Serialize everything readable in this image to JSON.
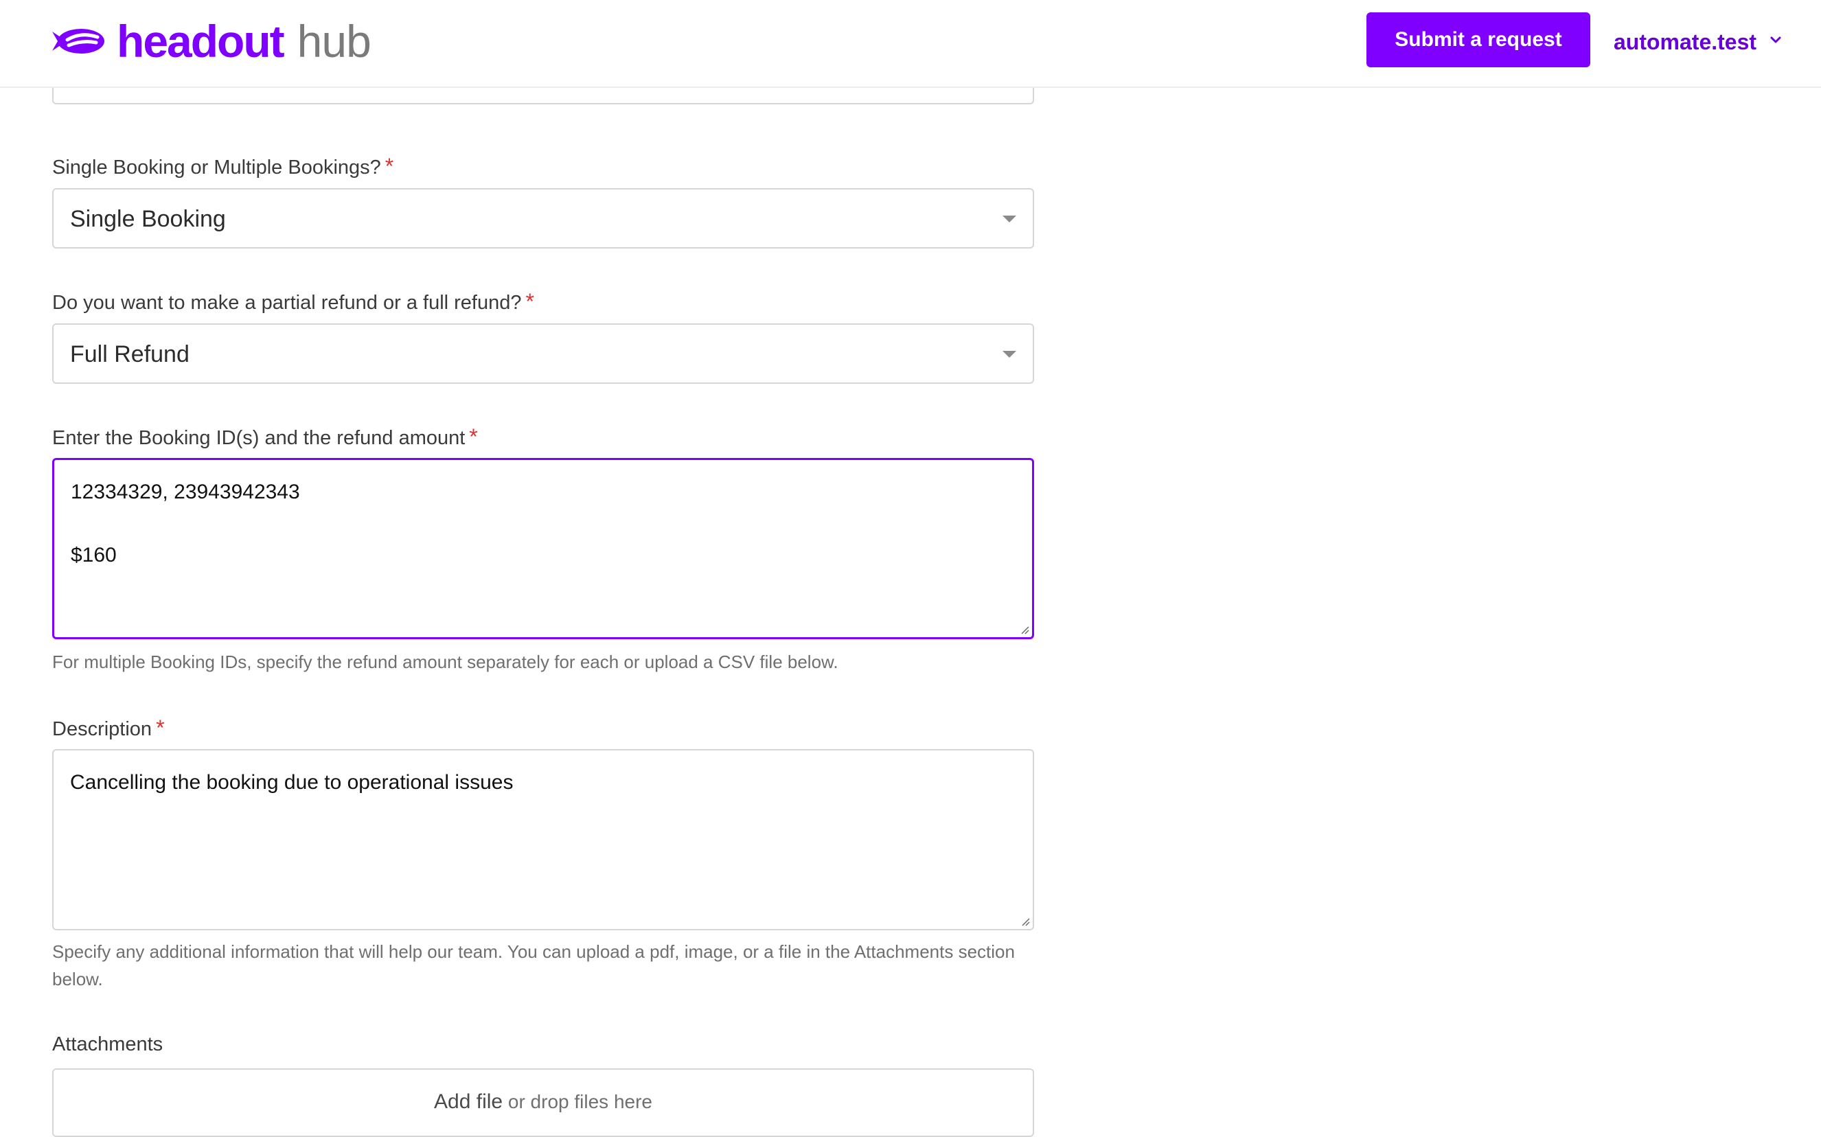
{
  "header": {
    "brand_name": "headout",
    "brand_sub": "hub",
    "submit_label": "Submit a request",
    "user_name": "automate.test",
    "brand_color": "#8000ff"
  },
  "form": {
    "booking_type": {
      "label": "Single Booking or Multiple Bookings?",
      "required_mark": "*",
      "value": "Single Booking"
    },
    "refund_type": {
      "label": "Do you want to make a partial refund or a full refund?",
      "required_mark": "*",
      "value": "Full Refund"
    },
    "booking_ids": {
      "label": "Enter the Booking ID(s) and the refund amount",
      "required_mark": "*",
      "value_lines": [
        "12334329, 23943942343",
        "",
        "$160"
      ],
      "hint": "For multiple Booking IDs, specify the refund amount separately for each or upload a CSV file below."
    },
    "description": {
      "label": "Description",
      "required_mark": "*",
      "value": "Cancelling the booking due to operational issues",
      "hint": "Specify any additional information that will help our team. You can upload a pdf, image, or a file in the Attachments section below."
    },
    "attachments": {
      "label": "Attachments",
      "add_file_label": "Add file",
      "drop_text": "or drop files here"
    }
  },
  "icons": {
    "logo": "blimp-logo-icon",
    "user_menu": "chevron-down-icon",
    "select_caret": "caret-down-icon",
    "resize": "resize-handle-icon"
  },
  "colors": {
    "accent": "#8000ff",
    "required": "#e03131",
    "focus_border": "#8000ff"
  }
}
